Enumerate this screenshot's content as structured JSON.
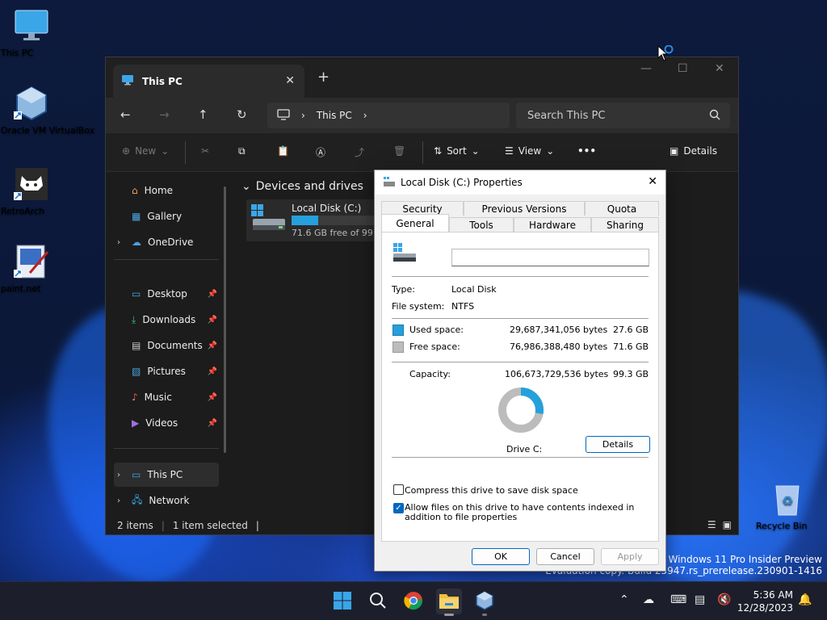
{
  "desktop": {
    "icons": [
      {
        "label": "This PC"
      },
      {
        "label": "Oracle VM VirtualBox"
      },
      {
        "label": "RetroArch"
      },
      {
        "label": "paint.net"
      },
      {
        "label": "Recycle Bin"
      }
    ],
    "watermark": {
      "line1": "Windows 11 Pro Insider Preview",
      "line2": "Evaluation copy. Build 25947.rs_prerelease.230901-1416"
    }
  },
  "explorer": {
    "tab_title": "This PC",
    "window_controls": {
      "minimize": "—",
      "maximize": "☐",
      "close": "✕"
    },
    "address": {
      "location": "This PC"
    },
    "search": {
      "placeholder": "Search This PC"
    },
    "commands": {
      "new": "New",
      "sort": "Sort",
      "view": "View",
      "more": "•••",
      "details": "Details"
    },
    "sidebar": {
      "home": "Home",
      "gallery": "Gallery",
      "onedrive": "OneDrive",
      "desktop": "Desktop",
      "downloads": "Downloads",
      "documents": "Documents",
      "pictures": "Pictures",
      "music": "Music",
      "videos": "Videos",
      "this_pc": "This PC",
      "network": "Network"
    },
    "main": {
      "section": "Devices and drives",
      "drive": {
        "name": "Local Disk (C:)",
        "free_text": "71.6 GB free of 99.3 GB",
        "used_fraction": 0.278
      }
    },
    "status": {
      "items": "2 items",
      "selected": "1 item selected"
    }
  },
  "dialog": {
    "title": "Local Disk (C:) Properties",
    "tabs_top": [
      "Security",
      "Previous Versions",
      "Quota"
    ],
    "tabs_bottom": [
      "General",
      "Tools",
      "Hardware",
      "Sharing"
    ],
    "active_tab": "General",
    "name_value": "",
    "type_label": "Type:",
    "type_value": "Local Disk",
    "fs_label": "File system:",
    "fs_value": "NTFS",
    "used_label": "Used space:",
    "used_bytes": "29,687,341,056 bytes",
    "used_gb": "27.6 GB",
    "free_label": "Free space:",
    "free_bytes": "76,986,388,480 bytes",
    "free_gb": "71.6 GB",
    "capacity_label": "Capacity:",
    "capacity_bytes": "106,673,729,536 bytes",
    "capacity_gb": "99.3 GB",
    "drive_label": "Drive C:",
    "details_button": "Details",
    "compress_label": "Compress this drive to save disk space",
    "compress_checked": false,
    "index_label": "Allow files on this drive to have contents indexed in addition to file properties",
    "index_checked": true,
    "ok": "OK",
    "cancel": "Cancel",
    "apply": "Apply",
    "colors": {
      "used": "#26a0da",
      "free": "#bcbcbc"
    }
  },
  "taskbar": {
    "time": "5:36 AM",
    "date": "12/28/2023"
  }
}
